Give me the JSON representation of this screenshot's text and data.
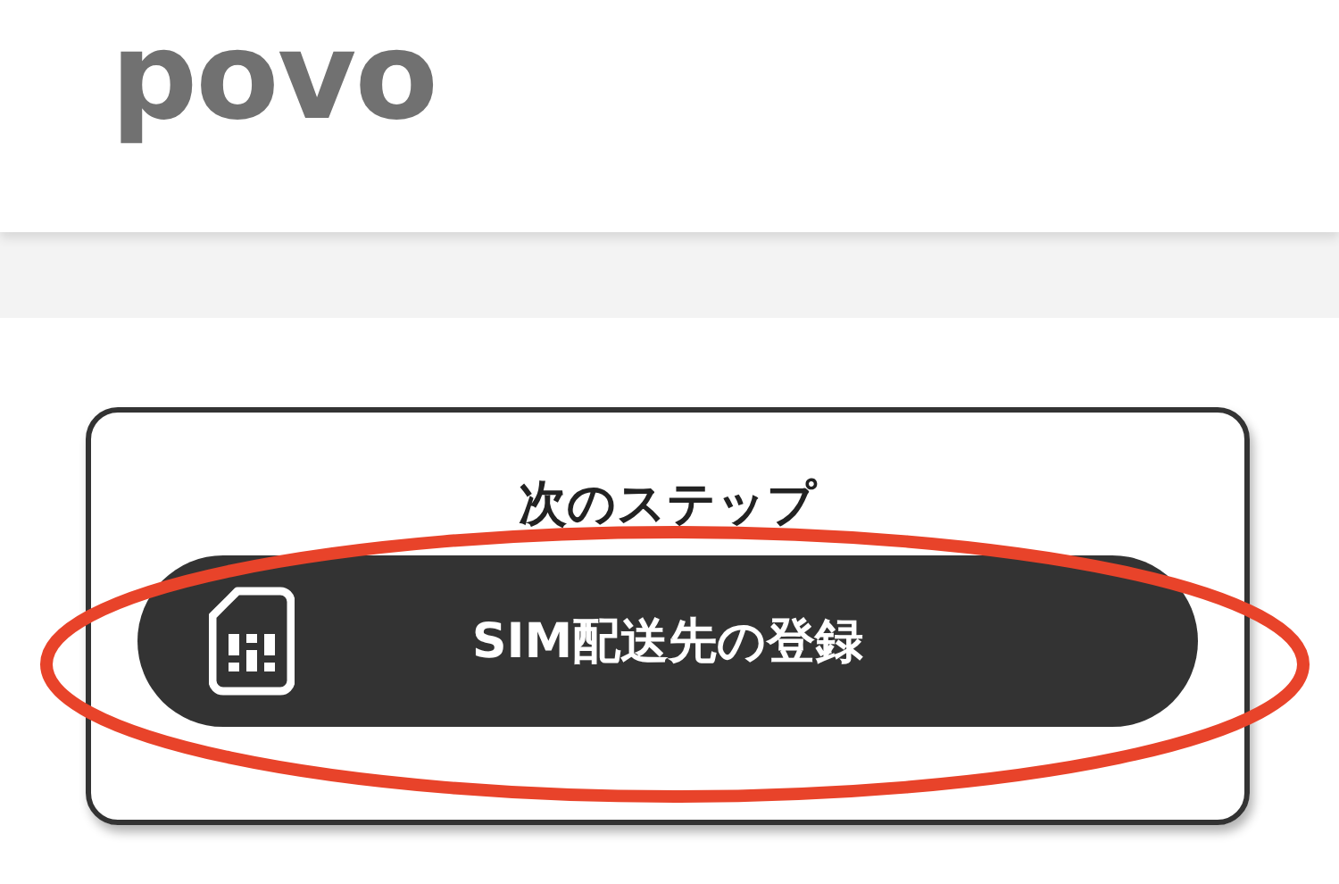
{
  "header": {
    "logo": "povo"
  },
  "card": {
    "title": "次のステップ",
    "button": {
      "label": "SIM配送先の登録"
    }
  },
  "annotation": {
    "kind": "ellipse",
    "color": "#e8432a"
  }
}
